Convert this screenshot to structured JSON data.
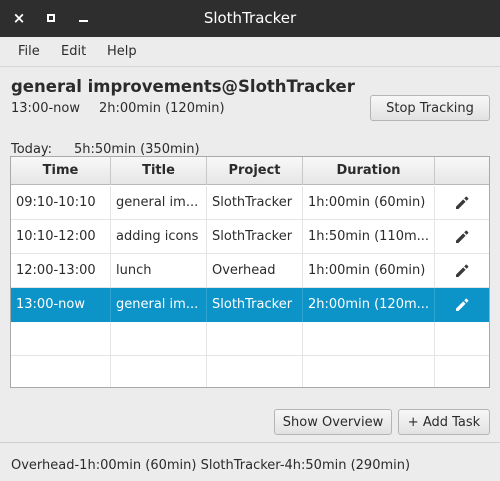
{
  "window": {
    "title": "SlothTracker",
    "close_glyph": "×"
  },
  "menu": {
    "items": [
      "File",
      "Edit",
      "Help"
    ]
  },
  "current_task": {
    "title": "general improvements@SlothTracker",
    "start": "13:00-now",
    "duration": "2h:00min (120min)",
    "stop_label": "Stop Tracking"
  },
  "today": {
    "label": "Today:",
    "value": "5h:50min (350min)"
  },
  "table": {
    "headers": [
      "Time",
      "Title",
      "Project",
      "Duration",
      ""
    ],
    "rows": [
      {
        "time": "09:10-10:10",
        "title": "general im...",
        "project": "SlothTracker",
        "duration": "1h:00min (60min)",
        "edit_icon": "pencil-icon"
      },
      {
        "time": "10:10-12:00",
        "title": "adding icons",
        "project": "SlothTracker",
        "duration": "1h:50min (110m...",
        "edit_icon": "pencil-icon"
      },
      {
        "time": "12:00-13:00",
        "title": "lunch",
        "project": "Overhead",
        "duration": "1h:00min (60min)",
        "edit_icon": "pencil-icon"
      },
      {
        "time": "13:00-now",
        "title": "general im...",
        "project": "SlothTracker",
        "duration": "2h:00min (120m...",
        "edit_icon": "pencil-icon"
      }
    ],
    "selected_row": 3,
    "selection_color": "#0c93c8"
  },
  "buttons": {
    "show_overview": "Show Overview",
    "add_task": "+ Add Task"
  },
  "status": {
    "text": "Overhead-1h:00min (60min)  SlothTracker-4h:50min (290min)"
  }
}
